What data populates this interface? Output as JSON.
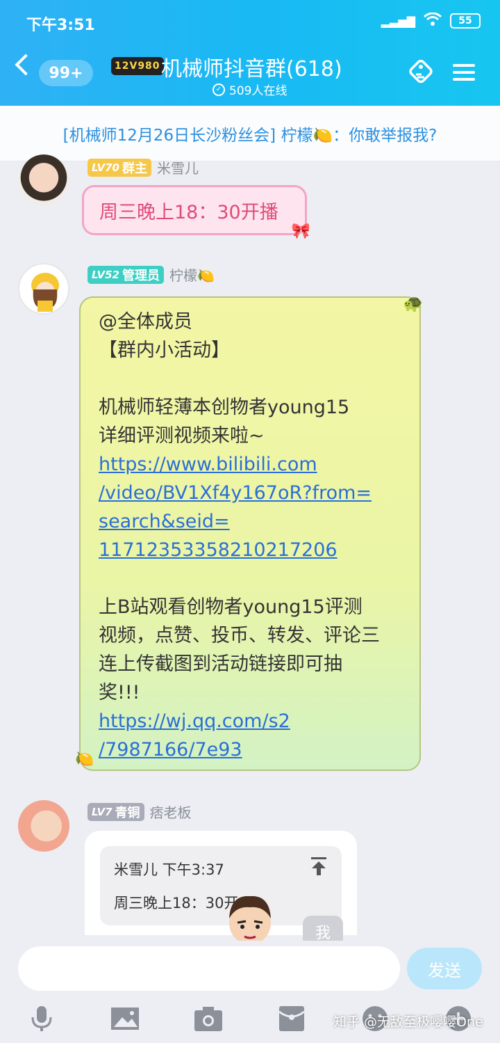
{
  "status_bar": {
    "time": "下午3:51",
    "battery": "55"
  },
  "header": {
    "unread_count": "99+",
    "group_badge": "12V980",
    "title": "机械师抖音群(618)",
    "online": "509人在线"
  },
  "pinned_notice": "[机械师12月26日长沙粉丝会] 柠檬🍋：你敢举报我?",
  "messages": [
    {
      "level": "LV70",
      "role": "群主",
      "sender": "米雪儿",
      "text": "周三晚上18：30开播"
    },
    {
      "level": "LV52",
      "role": "管理员",
      "sender": "柠檬🍋",
      "lines": [
        "@全体成员",
        "【群内小活动】",
        "",
        "机械师轻薄本创物者young15",
        "详细评测视频来啦~",
        "https://www.bilibili.com",
        "/video/BV1Xf4y167oR?from=",
        "search&seid=",
        "11712353358210217206",
        "",
        "上B站观看创物者young15评测",
        "视频，点赞、投币、转发、评论三",
        "连上传截图到活动链接即可抽",
        "奖!!!",
        "https://wj.qq.com/s2",
        "/7987166/7e93"
      ]
    },
    {
      "level": "LV7",
      "role": "青铜",
      "sender": "痞老板",
      "reply_header": "米雪儿 下午3:37",
      "reply_text": "周三晚上18：30开"
    }
  ],
  "me_label": "我",
  "input": {
    "placeholder": "",
    "send_label": "发送"
  },
  "watermark": "知乎 @无敌至极嘤嘤One",
  "colors": {
    "header": "#19b9f4",
    "link": "#2a6fd6",
    "owner_tag": "#f6c84a",
    "admin_tag": "#3dcfc4",
    "bronze_tag": "#a8acb8"
  }
}
